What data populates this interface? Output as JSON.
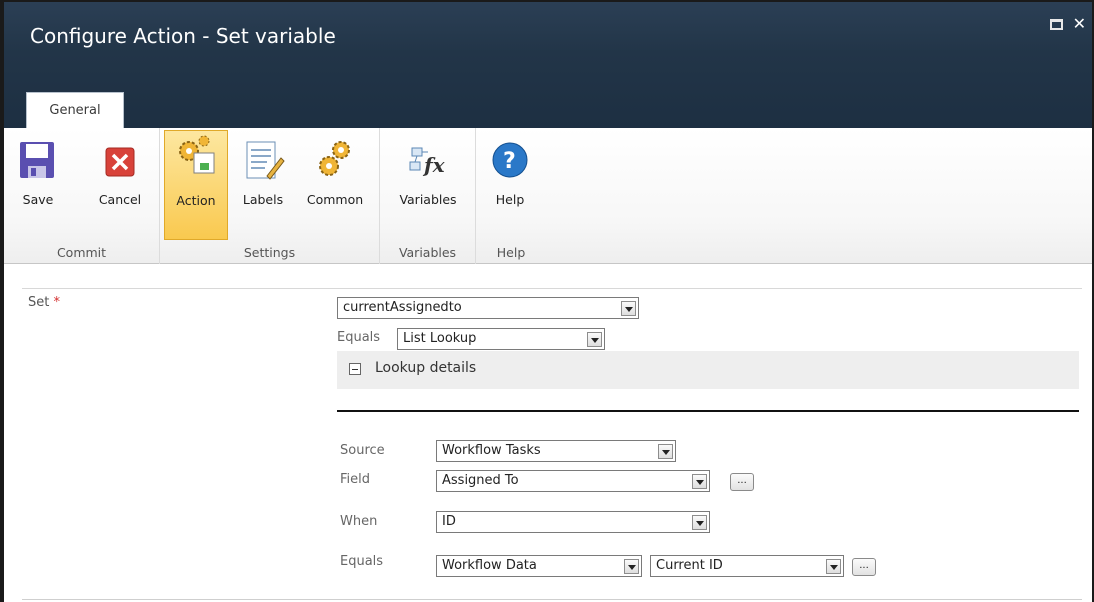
{
  "window": {
    "title": "Configure Action - Set variable",
    "tab_label": "General"
  },
  "ribbon": {
    "groups": [
      {
        "label": "Commit",
        "buttons": [
          {
            "label": "Save",
            "icon": "save-icon"
          },
          {
            "label": "Cancel",
            "icon": "cancel-icon"
          }
        ]
      },
      {
        "label": "Settings",
        "buttons": [
          {
            "label": "Action",
            "icon": "action-gears-icon",
            "active": true
          },
          {
            "label": "Labels",
            "icon": "labels-icon"
          },
          {
            "label": "Common",
            "icon": "common-gears-icon"
          }
        ]
      },
      {
        "label": "Variables",
        "buttons": [
          {
            "label": "Variables",
            "icon": "variables-fx-icon"
          }
        ]
      },
      {
        "label": "Help",
        "buttons": [
          {
            "label": "Help",
            "icon": "help-icon"
          }
        ]
      }
    ]
  },
  "form": {
    "set_label": "Set",
    "required_marker": "*",
    "variable_select": "currentAssignedto",
    "equals_label": "Equals",
    "equals_select": "List Lookup",
    "lookup_details": "Lookup details",
    "source_label": "Source",
    "source_select": "Workflow Tasks",
    "field_label": "Field",
    "field_select": "Assigned To",
    "when_label": "When",
    "when_select": "ID",
    "where_equals_label": "Equals",
    "where_equals_select1": "Workflow Data",
    "where_equals_select2": "Current ID",
    "ellipsis": "..."
  },
  "colors": {
    "titlebar": "#223548",
    "active_button": "#f9c94f",
    "required": "#d32f2f"
  }
}
